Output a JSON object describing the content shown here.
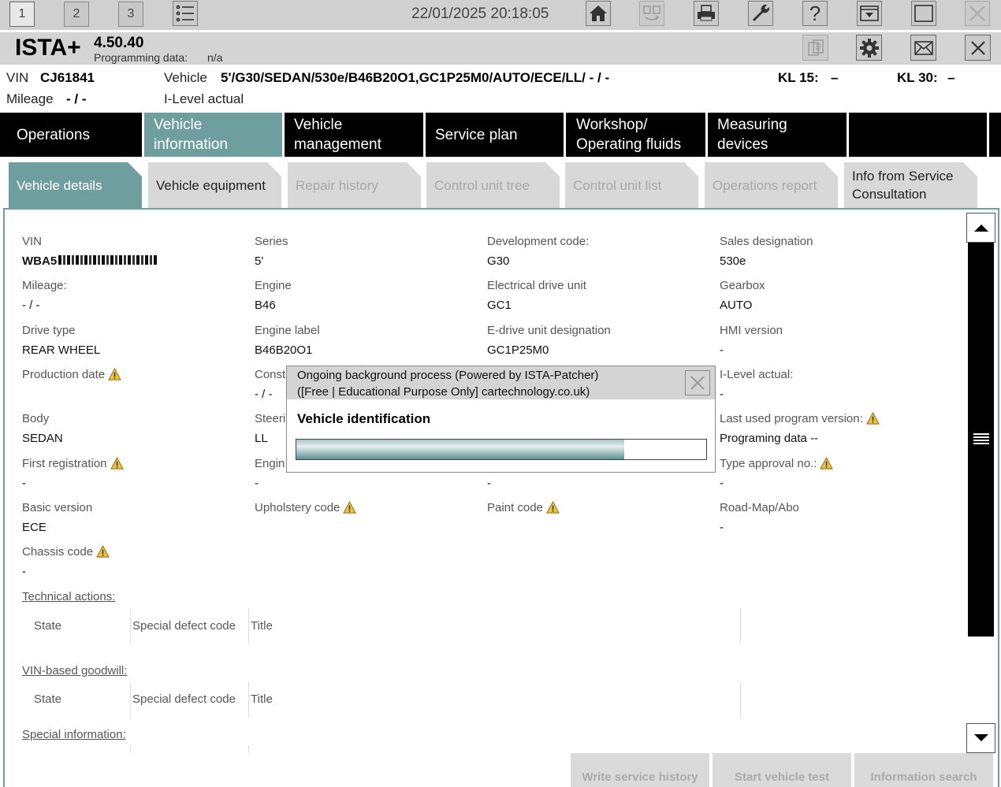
{
  "topbar": {
    "tab_numbers": [
      "1",
      "2",
      "3"
    ],
    "datetime": "22/01/2025 20:18:05",
    "icons": [
      "list-icon",
      "home-icon",
      "transfer-icon",
      "print-icon",
      "wrench-icon",
      "help-icon",
      "dropdown-icon",
      "window-icon",
      "close-icon"
    ],
    "help_glyph": "?"
  },
  "header": {
    "app_name": "ISTA+",
    "version": "4.50.40",
    "programming_data_label": "Programming data:",
    "programming_data_value": "n/a"
  },
  "vehicle_bar": {
    "vin_label": "VIN",
    "vin_value": "CJ61841",
    "vehicle_label": "Vehicle",
    "vehicle_value": "5'/G30/SEDAN/530e/B46B20O1,GC1P25M0/AUTO/ECE/LL/ - / -",
    "kl15_label": "KL 15:",
    "kl15_value": "–",
    "kl30_label": "KL 30:",
    "kl30_value": "–",
    "mileage_label": "Mileage",
    "mileage_value": "- / -",
    "ilevel_label": "I-Level actual"
  },
  "main_nav": [
    {
      "label": "Operations"
    },
    {
      "label": "Vehicle information"
    },
    {
      "label": "Vehicle management"
    },
    {
      "label": "Service plan"
    },
    {
      "label": "Workshop/ Operating fluids"
    },
    {
      "label": "Measuring devices"
    },
    {
      "label": ""
    }
  ],
  "sub_tabs": [
    {
      "label": "Vehicle details"
    },
    {
      "label": "Vehicle equipment"
    },
    {
      "label": "Repair history"
    },
    {
      "label": "Control unit tree"
    },
    {
      "label": "Control unit list"
    },
    {
      "label": "Operations report"
    },
    {
      "label": "Info from Service Consultation"
    }
  ],
  "fields": {
    "vin": {
      "label": "VIN",
      "value": "WBA5"
    },
    "series": {
      "label": "Series",
      "value": "5'"
    },
    "development_code": {
      "label": "Development code:",
      "value": "G30"
    },
    "sales_designation": {
      "label": "Sales designation",
      "value": "530e"
    },
    "mileage": {
      "label": "Mileage:",
      "value": "- / -"
    },
    "engine": {
      "label": "Engine",
      "value": "B46"
    },
    "electrical_drive_unit": {
      "label": "Electrical drive unit",
      "value": "GC1"
    },
    "gearbox": {
      "label": "Gearbox",
      "value": "AUTO"
    },
    "drive_type": {
      "label": "Drive type",
      "value": "REAR WHEEL"
    },
    "engine_label": {
      "label": "Engine label",
      "value": "B46B20O1"
    },
    "edrive_designation": {
      "label": "E-drive unit designation",
      "value": "GC1P25M0"
    },
    "hmi_version": {
      "label": "HMI version",
      "value": "-"
    },
    "production_date": {
      "label": "Production date",
      "value": ""
    },
    "construction": {
      "label": "Const",
      "value": "- / -"
    },
    "ilevel_actual": {
      "label": "I-Level actual:",
      "value": "-"
    },
    "body": {
      "label": "Body",
      "value": "SEDAN"
    },
    "steering": {
      "label": "Steeri",
      "value": "LL"
    },
    "last_program_version": {
      "label": "Last used program version:",
      "value": "Programing data --"
    },
    "first_registration": {
      "label": "First registration",
      "value": "-"
    },
    "engine2": {
      "label": "Engin",
      "value": "-"
    },
    "col3_row6": {
      "value": "-"
    },
    "type_approval": {
      "label": "Type approval no.:",
      "value": "-"
    },
    "basic_version": {
      "label": "Basic version",
      "value": "ECE"
    },
    "upholstery_code": {
      "label": "Upholstery code"
    },
    "paint_code": {
      "label": "Paint code"
    },
    "road_map": {
      "label": "Road-Map/Abo",
      "value": "-"
    },
    "chassis_code": {
      "label": "Chassis code",
      "value": "-"
    }
  },
  "sections": {
    "technical_actions": "Technical actions:",
    "vin_goodwill": "VIN-based goodwill:",
    "special_information": "Special information:",
    "col_state": "State",
    "col_defect": "Special defect code",
    "col_title": "Title"
  },
  "bottom_buttons": {
    "write_history": "Write service history",
    "start_test": "Start vehicle test",
    "info_search": "Information search"
  },
  "dialog": {
    "title_line1": "Ongoing background process (Powered by ISTA-Patcher)",
    "title_line2": "([Free | Educational Purpose Only] cartechnology.co.uk)",
    "message": "Vehicle identification",
    "progress": 0.8
  },
  "colors": {
    "accent": "#6f9e9e",
    "nav_bg": "#000000",
    "warning": "#f0c040"
  }
}
